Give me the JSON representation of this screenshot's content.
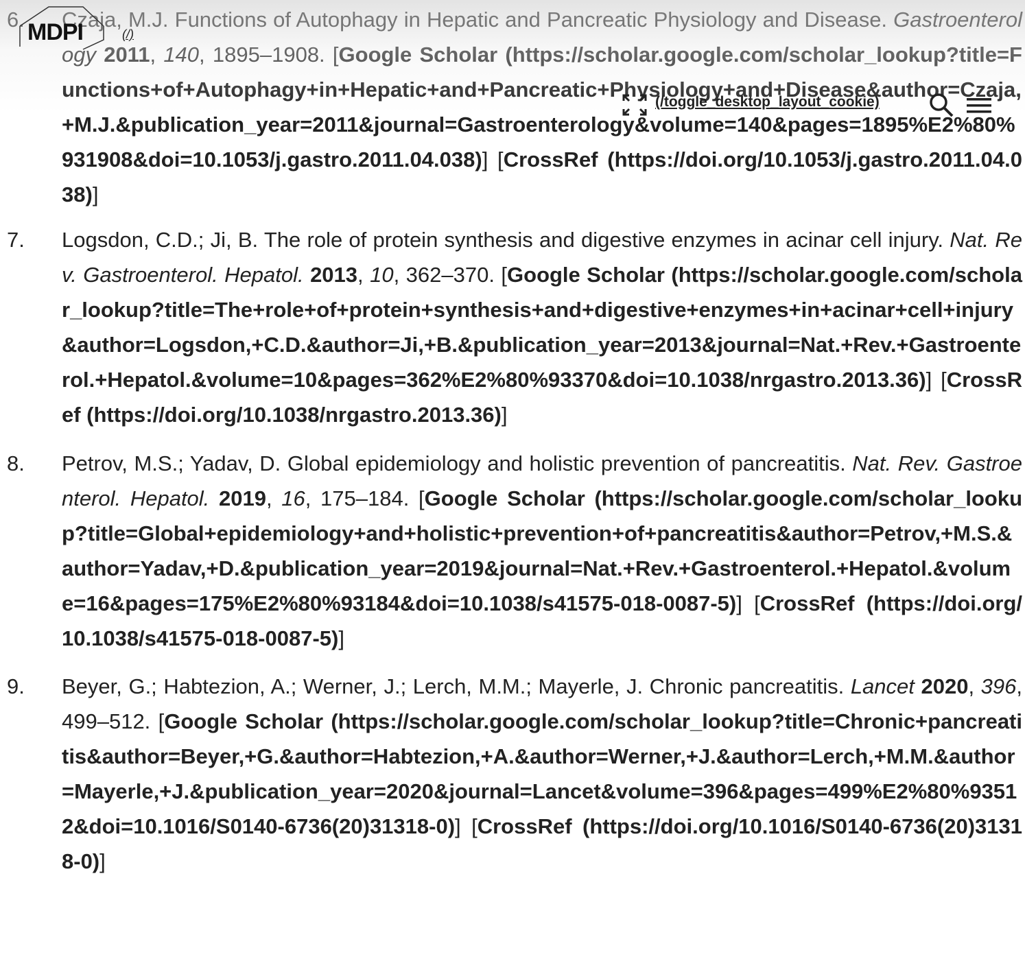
{
  "header": {
    "logo_text": "MDPI",
    "logo_link": "(/)",
    "toggle_link": "(/toggle_desktop_layout_cookie)",
    "icons": [
      "expand-icon",
      "search-icon",
      "menu-icon"
    ]
  },
  "references": [
    {
      "number": "6.",
      "authors_title": "Czaja, M.J. Functions of Autophagy in Hepatic and Pancreatic Physiology and Disease.",
      "journal": "Gastroenterology",
      "year": "2011",
      "volume": "140",
      "pages": "1895–1908.",
      "google_scholar": "Google Scholar (https://scholar.google.com/scholar_lookup?title=Functions+of+Autophagy+in+Hepatic+and+Pancreatic+Physiology+and+Disease&author=Czaja,+M.J.&publication_year=2011&journal=Gastroenterology&volume=140&pages=1895%E2%80%931908&doi=10.1053/j.gastro.2011.04.038)",
      "crossref": "CrossRef (https://doi.org/10.1053/j.gastro.2011.04.038)"
    },
    {
      "number": "7.",
      "authors_title": "Logsdon, C.D.; Ji, B. The role of protein synthesis and digestive enzymes in acinar cell injury.",
      "journal": "Nat. Rev. Gastroenterol. Hepatol.",
      "year": "2013",
      "volume": "10",
      "pages": "362–370.",
      "google_scholar": "Google Scholar (https://scholar.google.com/scholar_lookup?title=The+role+of+protein+synthesis+and+digestive+enzymes+in+acinar+cell+injury&author=Logsdon,+C.D.&author=Ji,+B.&publication_year=2013&journal=Nat.+Rev.+Gastroenterol.+Hepatol.&volume=10&pages=362%E2%80%93370&doi=10.1038/nrgastro.2013.36)",
      "crossref": "CrossRef (https://doi.org/10.1038/nrgastro.2013.36)"
    },
    {
      "number": "8.",
      "authors_title": "Petrov, M.S.; Yadav, D. Global epidemiology and holistic prevention of pancreatitis.",
      "journal": "Nat. Rev. Gastroenterol. Hepatol.",
      "year": "2019",
      "volume": "16",
      "pages": "175–184.",
      "google_scholar": "Google Scholar (https://scholar.google.com/scholar_lookup?title=Global+epidemiology+and+holistic+prevention+of+pancreatitis&author=Petrov,+M.S.&author=Yadav,+D.&publication_year=2019&journal=Nat.+Rev.+Gastroenterol.+Hepatol.&volume=16&pages=175%E2%80%93184&doi=10.1038/s41575-018-0087-5)",
      "crossref": "CrossRef (https://doi.org/10.1038/s41575-018-0087-5)"
    },
    {
      "number": "9.",
      "authors_title": "Beyer, G.; Habtezion, A.; Werner, J.; Lerch, M.M.; Mayerle, J. Chronic pancreatitis.",
      "journal": "Lancet",
      "year": "2020",
      "volume": "396",
      "pages": "499–512.",
      "google_scholar": "Google Scholar (https://scholar.google.com/scholar_lookup?title=Chronic+pancreatitis&author=Beyer,+G.&author=Habtezion,+A.&author=Werner,+J.&author=Lerch,+M.M.&author=Mayerle,+J.&publication_year=2020&journal=Lancet&volume=396&pages=499%E2%80%93512&doi=10.1016/S0140-6736(20)31318-0)",
      "crossref": "CrossRef (https://doi.org/10.1016/S0140-6736(20)31318-0)"
    }
  ]
}
